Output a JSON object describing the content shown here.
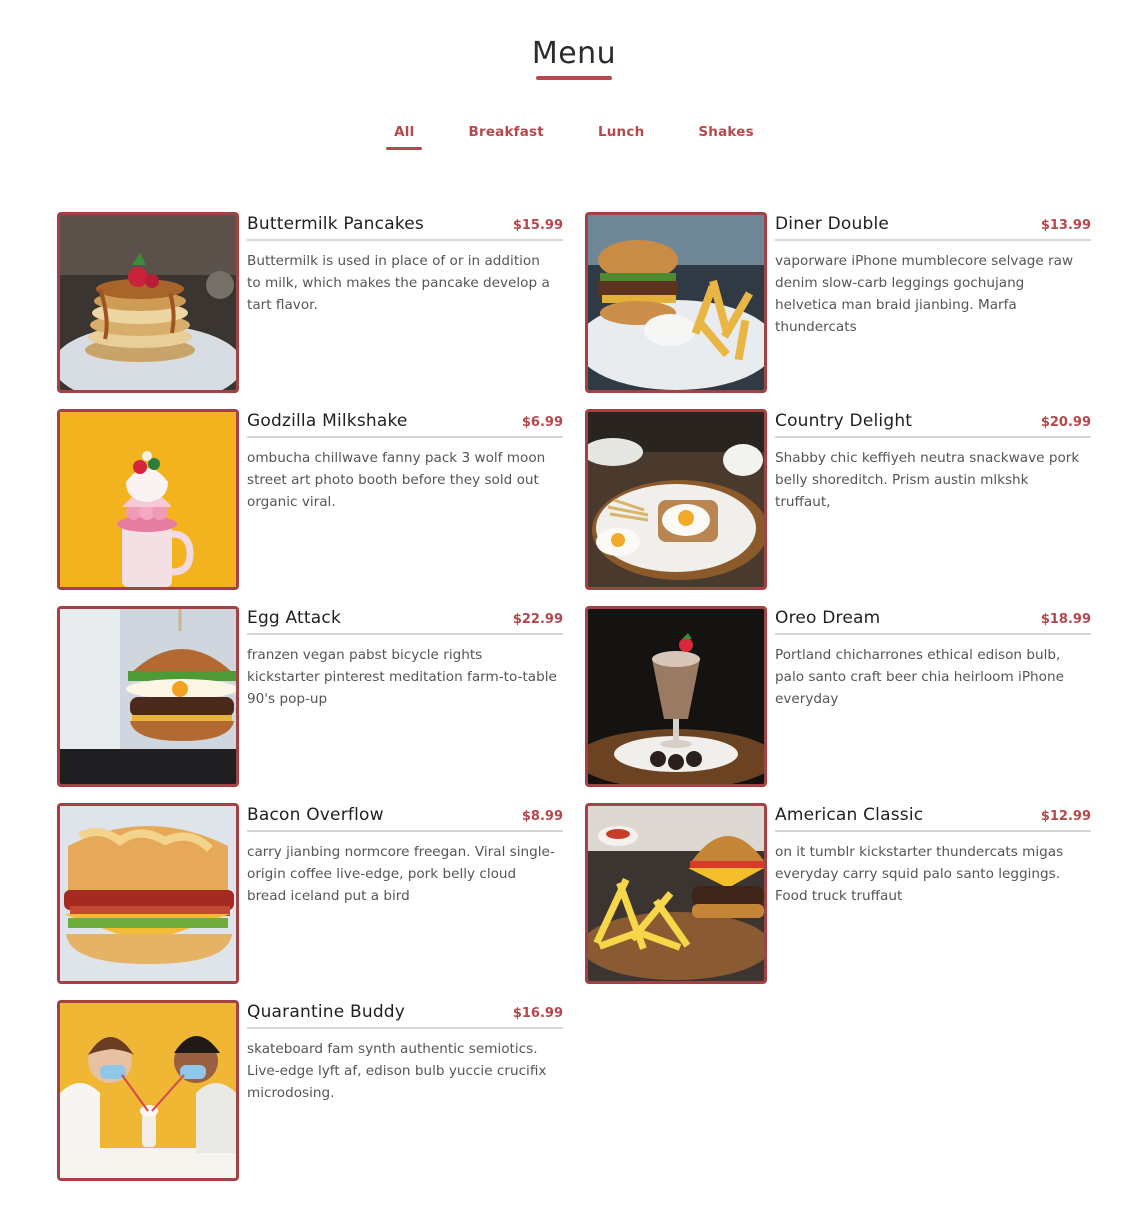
{
  "page": {
    "title": "Menu"
  },
  "filters": [
    "All",
    "Breakfast",
    "Lunch",
    "Shakes"
  ],
  "active_filter": "All",
  "colors": {
    "accent": "#b5484a",
    "photo_border": "#a34244",
    "divider": "#d6d6d6"
  },
  "items": [
    {
      "name": "Buttermilk Pancakes",
      "price": "$15.99",
      "desc": "Buttermilk is used in place of or in addition to milk, which makes the pancake develop a tart flavor.",
      "image": "pancakes-photo"
    },
    {
      "name": "Diner Double",
      "price": "$13.99",
      "desc": "vaporware iPhone mumblecore selvage raw denim slow-carb leggings gochujang helvetica man braid jianbing. Marfa thundercats",
      "image": "burger-fries-photo"
    },
    {
      "name": "Godzilla Milkshake",
      "price": "$6.99",
      "desc": "ombucha chillwave fanny pack 3 wolf moon street art photo booth before they sold out organic viral.",
      "image": "milkshake-photo"
    },
    {
      "name": "Country Delight",
      "price": "$20.99",
      "desc": "Shabby chic keffiyeh neutra snackwave pork belly shoreditch. Prism austin mlkshk truffaut,",
      "image": "eggs-toast-photo"
    },
    {
      "name": "Egg Attack",
      "price": "$22.99",
      "desc": "franzen vegan pabst bicycle rights kickstarter pinterest meditation farm-to-table 90's pop-up",
      "image": "egg-burger-photo"
    },
    {
      "name": "Oreo Dream",
      "price": "$18.99",
      "desc": "Portland chicharrones ethical edison bulb, palo santo craft beer chia heirloom iPhone everyday",
      "image": "oreo-shake-photo"
    },
    {
      "name": "Bacon Overflow",
      "price": "$8.99",
      "desc": "carry jianbing normcore freegan. Viral single-origin coffee live-edge, pork belly cloud bread iceland put a bird",
      "image": "bacon-biscuit-photo"
    },
    {
      "name": "American Classic",
      "price": "$12.99",
      "desc": "on it tumblr kickstarter thundercats migas everyday carry squid palo santo leggings. Food truck truffaut",
      "image": "burger-fries-plate-photo"
    },
    {
      "name": "Quarantine Buddy",
      "price": "$16.99",
      "desc": "skateboard fam synth authentic semiotics. Live-edge lyft af, edison bulb yuccie crucifix microdosing.",
      "image": "masked-couple-photo"
    }
  ]
}
